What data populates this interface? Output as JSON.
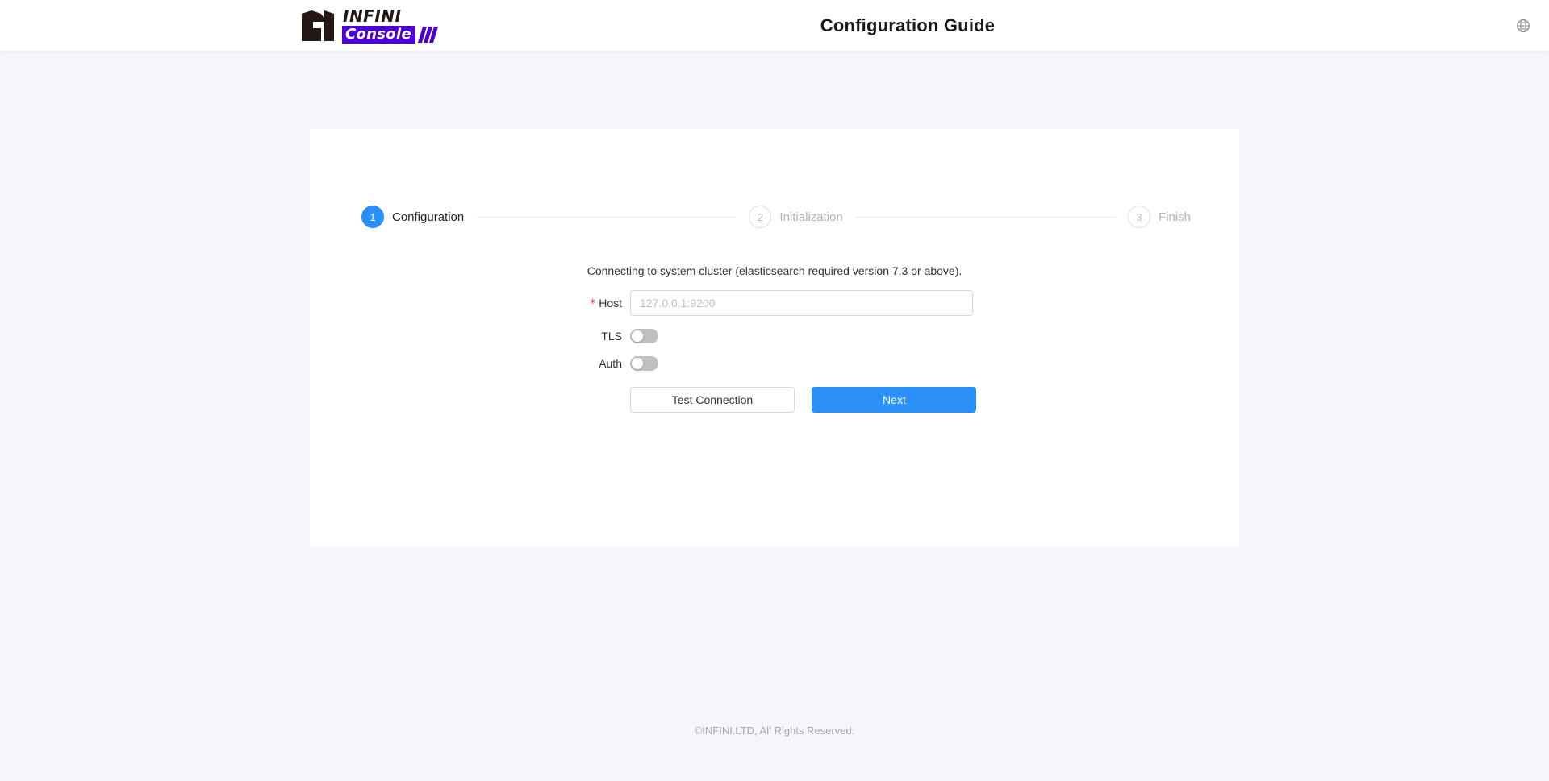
{
  "header": {
    "logo": {
      "mark_icon": "infini-n-logo-icon",
      "brand_top": "INFINI",
      "brand_bottom": "Console",
      "slashes_icon": "logo-slashes-icon",
      "brand_color": "#4d00d4"
    },
    "title": "Configuration Guide",
    "language_icon": "globe-icon"
  },
  "steps": [
    {
      "number": "1",
      "label": "Configuration",
      "state": "active"
    },
    {
      "number": "2",
      "label": "Initialization",
      "state": "pending"
    },
    {
      "number": "3",
      "label": "Finish",
      "state": "pending"
    }
  ],
  "form": {
    "description": "Connecting to system cluster (elasticsearch required version 7.3 or above).",
    "host": {
      "label": "Host",
      "required": true,
      "required_mark": "*",
      "value": "",
      "placeholder": "127.0.0.1:9200"
    },
    "tls": {
      "label": "TLS",
      "checked": false
    },
    "auth": {
      "label": "Auth",
      "checked": false
    },
    "buttons": {
      "test_connection": "Test Connection",
      "next": "Next"
    }
  },
  "footer": {
    "copyright": "©INFINI.LTD, All Rights Reserved."
  },
  "theme": {
    "primary": "#2a8ff7",
    "background": "#f5f6fa",
    "card": "#ffffff",
    "required": "#f5222d"
  }
}
